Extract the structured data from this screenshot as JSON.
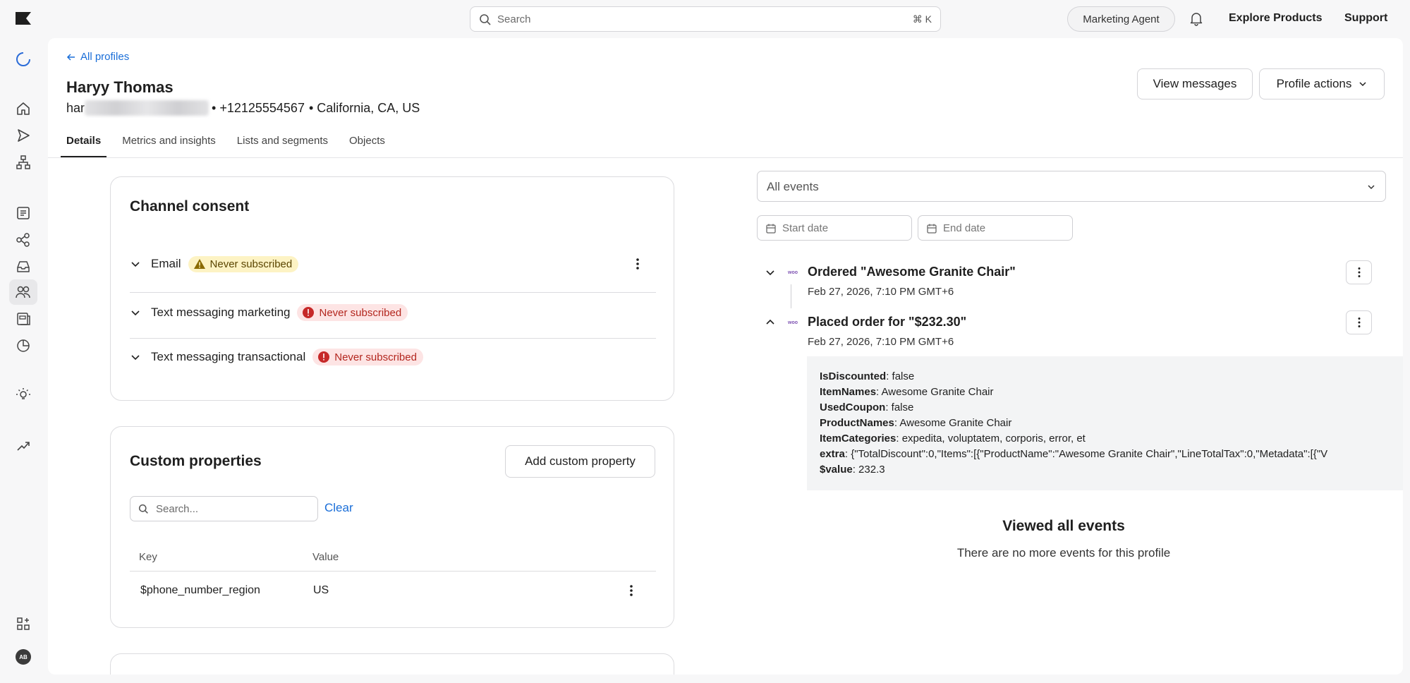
{
  "topbar": {
    "search_placeholder": "Search",
    "search_shortcut": "⌘ K",
    "agent_label": "Marketing Agent",
    "explore_label": "Explore Products",
    "support_label": "Support"
  },
  "sidebar": {
    "avatar_initials": "AB",
    "items": [
      "loading-icon",
      "home-icon",
      "send-icon",
      "flows-icon",
      "list-icon",
      "segments-icon",
      "inbox-icon",
      "audience-icon",
      "content-icon",
      "analytics-icon",
      "ideas-icon",
      "trend-icon",
      "apps-icon"
    ]
  },
  "profile": {
    "back_label": "All profiles",
    "name": "Haryy Thomas",
    "email_prefix": "har",
    "phone": "• +12125554567",
    "location": "• California, CA, US",
    "view_messages_label": "View messages",
    "profile_actions_label": "Profile actions"
  },
  "tabs": [
    "Details",
    "Metrics and insights",
    "Lists and segments",
    "Objects"
  ],
  "consent": {
    "title": "Channel consent",
    "rows": [
      {
        "label": "Email",
        "status": "Never subscribed",
        "type": "warning"
      },
      {
        "label": "Text messaging marketing",
        "status": "Never subscribed",
        "type": "error"
      },
      {
        "label": "Text messaging transactional",
        "status": "Never subscribed",
        "type": "error"
      }
    ]
  },
  "custom_properties": {
    "title": "Custom properties",
    "add_label": "Add custom property",
    "search_placeholder": "Search...",
    "clear_label": "Clear",
    "col_key": "Key",
    "col_value": "Value",
    "rows": [
      {
        "key": "$phone_number_region",
        "value": "US"
      }
    ]
  },
  "events": {
    "filter_value": "All events",
    "start_placeholder": "Start date",
    "end_placeholder": "End date",
    "items": [
      {
        "title": "Ordered \"Awesome Granite Chair\"",
        "time": "Feb 27, 2026, 7:10 PM GMT+6"
      },
      {
        "title": "Placed order for \"$232.30\"",
        "time": "Feb 27, 2026, 7:10 PM GMT+6"
      }
    ],
    "properties": [
      {
        "key": "IsDiscounted",
        "value": ": false"
      },
      {
        "key": "ItemNames",
        "value": ": Awesome Granite Chair"
      },
      {
        "key": "UsedCoupon",
        "value": ": false"
      },
      {
        "key": "ProductNames",
        "value": ": Awesome Granite Chair"
      },
      {
        "key": "ItemCategories",
        "value": ": expedita, voluptatem, corporis, error, et"
      },
      {
        "key": "extra",
        "value": ": {\"TotalDiscount\":0,\"Items\":[{\"ProductName\":\"Awesome Granite Chair\",\"LineTotalTax\":0,\"Metadata\":[{\"V"
      },
      {
        "key": "$value",
        "value": ": 232.3"
      }
    ],
    "end_title": "Viewed all events",
    "end_subtitle": "There are no more events for this profile"
  },
  "colors": {
    "link": "#1a6ed8",
    "warning_bg": "#fdf3c4",
    "error_bg": "#fde4e4",
    "error_text": "#b3261e",
    "woo_purple": "#7f54b3"
  }
}
